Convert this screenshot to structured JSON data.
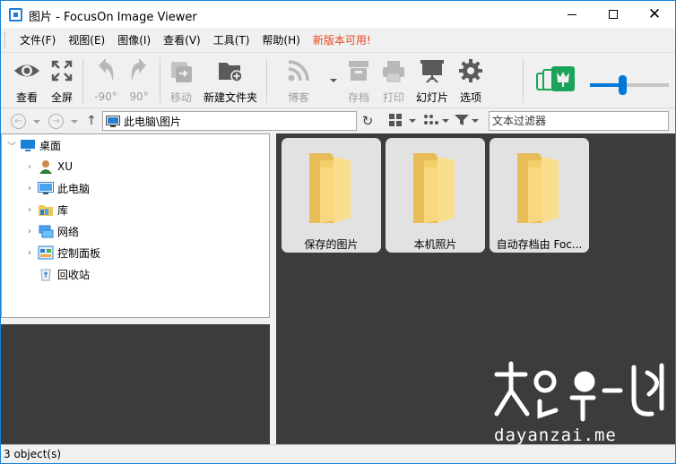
{
  "window": {
    "title": "图片 - FocusOn Image Viewer",
    "accent_color": "#1883d7"
  },
  "menu": {
    "items": [
      "文件(F)",
      "视图(E)",
      "图像(I)",
      "查看(V)",
      "工具(T)",
      "帮助(H)"
    ],
    "update_label": "新版本可用!",
    "update_color": "#e8441b"
  },
  "toolbar": {
    "view": "查看",
    "fullscreen": "全屏",
    "rotate_left": "-90°",
    "rotate_right": "90°",
    "move": "移动",
    "new_folder": "新建文件夹",
    "blog": "博客",
    "save": "存档",
    "print": "打印",
    "slideshow": "幻灯片",
    "options": "选项",
    "zoom_slider_value": 0.4
  },
  "address": {
    "path": "此电脑\\图片",
    "filter_placeholder": "文本过滤器"
  },
  "tree": {
    "root": "桌面",
    "items": [
      {
        "label": "XU",
        "icon": "user-icon"
      },
      {
        "label": "此电脑",
        "icon": "computer-icon"
      },
      {
        "label": "库",
        "icon": "library-icon"
      },
      {
        "label": "网络",
        "icon": "network-icon"
      },
      {
        "label": "控制面板",
        "icon": "control-panel-icon"
      },
      {
        "label": "回收站",
        "icon": "recycle-bin-icon"
      }
    ]
  },
  "browser": {
    "folders": [
      {
        "label": "保存的图片"
      },
      {
        "label": "本机照片"
      },
      {
        "label": "自动存档由 Foc..."
      }
    ]
  },
  "watermark": {
    "url": "dayanzai.me"
  },
  "status": {
    "text": "3 object(s)"
  }
}
